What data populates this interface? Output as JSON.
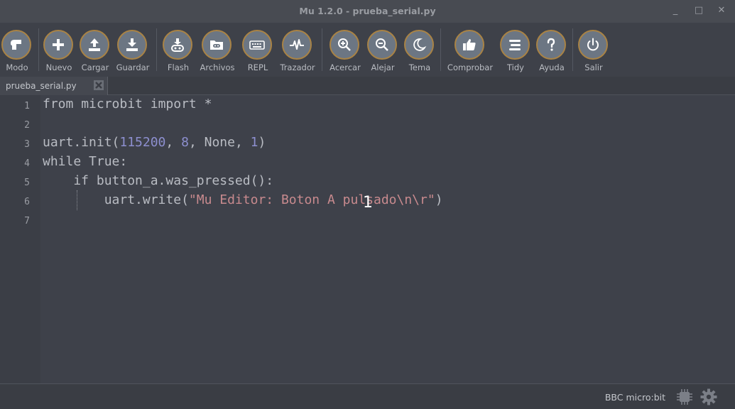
{
  "window": {
    "title": "Mu 1.2.0 - prueba_serial.py",
    "minimize": "_",
    "maximize": "□",
    "close": "✕"
  },
  "toolbar": {
    "buttons": [
      {
        "label": "Modo",
        "icon": "mode-icon"
      },
      {
        "label": "Nuevo",
        "icon": "plus-icon"
      },
      {
        "label": "Cargar",
        "icon": "upload-icon"
      },
      {
        "label": "Guardar",
        "icon": "download-icon"
      },
      {
        "label": "Flash",
        "icon": "flash-icon"
      },
      {
        "label": "Archivos",
        "icon": "folder-icon"
      },
      {
        "label": "REPL",
        "icon": "keyboard-icon"
      },
      {
        "label": "Trazador",
        "icon": "pulse-icon"
      },
      {
        "label": "Acercar",
        "icon": "zoom-in-icon"
      },
      {
        "label": "Alejar",
        "icon": "zoom-out-icon"
      },
      {
        "label": "Tema",
        "icon": "moon-icon"
      },
      {
        "label": "Comprobar",
        "icon": "thumbs-up-icon"
      },
      {
        "label": "Tidy",
        "icon": "lines-icon"
      },
      {
        "label": "Ayuda",
        "icon": "question-icon"
      },
      {
        "label": "Salir",
        "icon": "power-icon"
      }
    ]
  },
  "tabs": [
    {
      "label": "prueba_serial.py",
      "active": true
    }
  ],
  "editor": {
    "line_numbers": [
      "1",
      "2",
      "3",
      "4",
      "5",
      "6",
      "7"
    ],
    "lines": {
      "l1": {
        "kw1": "from",
        "mod": " microbit ",
        "kw2": "import",
        "rest": " *"
      },
      "l3": {
        "a": "uart.init(",
        "n1": "115200",
        "c1": ", ",
        "n2": "8",
        "c2": ", None, ",
        "n3": "1",
        "e": ")"
      },
      "l4": {
        "text": "while True:"
      },
      "l5": {
        "text": "    if button_a.was_pressed():"
      },
      "l6": {
        "a": "        uart.write(",
        "s": "\"Mu Editor: Boton A pulsado\\n\\r\"",
        "e": ")"
      }
    },
    "overlay_number": "1"
  },
  "status": {
    "mode": "BBC micro:bit"
  },
  "colors": {
    "accent": "#a98345",
    "button_fill": "#6c7683",
    "string": "#c88a8e",
    "number": "#8d8fcf"
  }
}
